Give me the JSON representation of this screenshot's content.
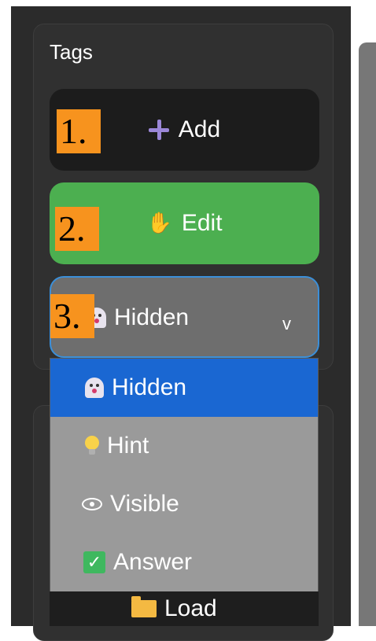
{
  "panel": {
    "title": "Tags",
    "add_button": {
      "label": "Add",
      "icon": "plus-icon",
      "badge": "1."
    },
    "edit_button": {
      "label": "Edit",
      "icon": "hand-icon",
      "badge": "2."
    },
    "visibility_select": {
      "selected": "Hidden",
      "icon": "ghost-icon",
      "chevron": "v",
      "badge": "3."
    }
  },
  "dropdown": {
    "options": [
      {
        "label": "Hidden",
        "icon": "ghost-icon"
      },
      {
        "label": "Hint",
        "icon": "lightbulb-icon"
      },
      {
        "label": "Visible",
        "icon": "eye-icon"
      },
      {
        "label": "Answer",
        "icon": "check-icon"
      }
    ]
  },
  "load_button": {
    "label": "Load",
    "icon": "folder-icon"
  },
  "colors": {
    "edit_green": "#4caf50",
    "selected_blue": "#1a67d2",
    "badge_orange": "#f7931e",
    "focus_border": "#3b8fd9"
  }
}
